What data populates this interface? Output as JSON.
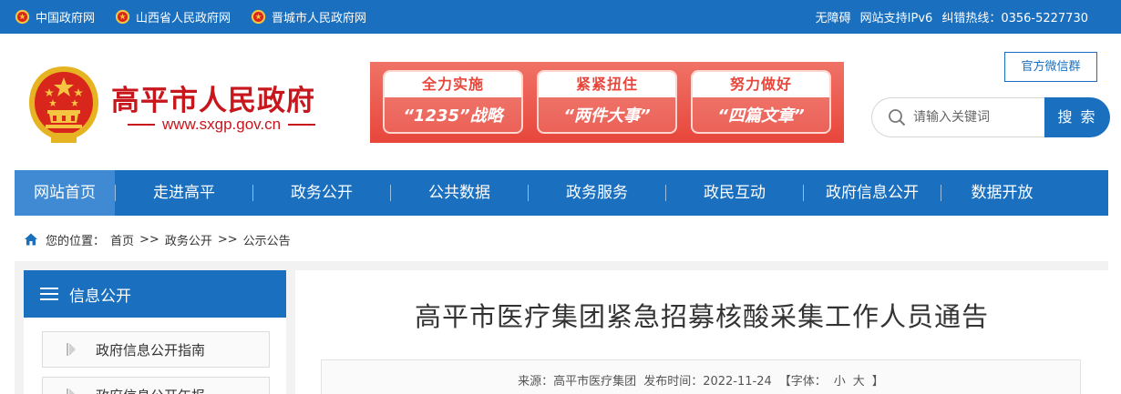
{
  "topbar": {
    "links": [
      {
        "label": "中国政府网"
      },
      {
        "label": "山西省人民政府网"
      },
      {
        "label": "晋城市人民政府网"
      }
    ],
    "accessibility": "无障碍",
    "ipv6": "网站支持IPv6",
    "hotline": "纠错热线：0356-5227730"
  },
  "header": {
    "site_name": "高平市人民政府",
    "site_url": "www.sxgp.gov.cn",
    "banner": [
      {
        "top": "全力实施",
        "bottom": "“1235”战略"
      },
      {
        "top": "紧紧扭住",
        "bottom": "“两件大事”"
      },
      {
        "top": "努力做好",
        "bottom": "“四篇文章”"
      }
    ],
    "wechat_label": "官方微信群",
    "search_placeholder": "请输入关键词",
    "search_button": "搜 索"
  },
  "nav": {
    "items": [
      {
        "label": "网站首页",
        "active": true
      },
      {
        "label": "走进高平"
      },
      {
        "label": "政务公开"
      },
      {
        "label": "公共数据"
      },
      {
        "label": "政务服务"
      },
      {
        "label": "政民互动"
      },
      {
        "label": "政府信息公开"
      },
      {
        "label": "数据开放"
      }
    ]
  },
  "breadcrumb": {
    "prefix": "您的位置：",
    "items": [
      "首页",
      "政务公开",
      "公示公告"
    ],
    "separator": ">>"
  },
  "sidebar": {
    "title": "信息公开",
    "items": [
      {
        "label": "政府信息公开指南"
      },
      {
        "label": "政府信息公开年报"
      }
    ]
  },
  "article": {
    "title": "高平市医疗集团紧急招募核酸采集工作人员通告",
    "source": "来源：高平市医疗集团",
    "date": "发布时间：2022-11-24",
    "font_label": "【字体：",
    "font_small": "小",
    "font_large": "大",
    "font_end": "】"
  },
  "colors": {
    "primary": "#1a6fbf",
    "nav_active": "#3f8ad3",
    "brand_red": "#c8161d",
    "banner_red": "#e8463b"
  }
}
